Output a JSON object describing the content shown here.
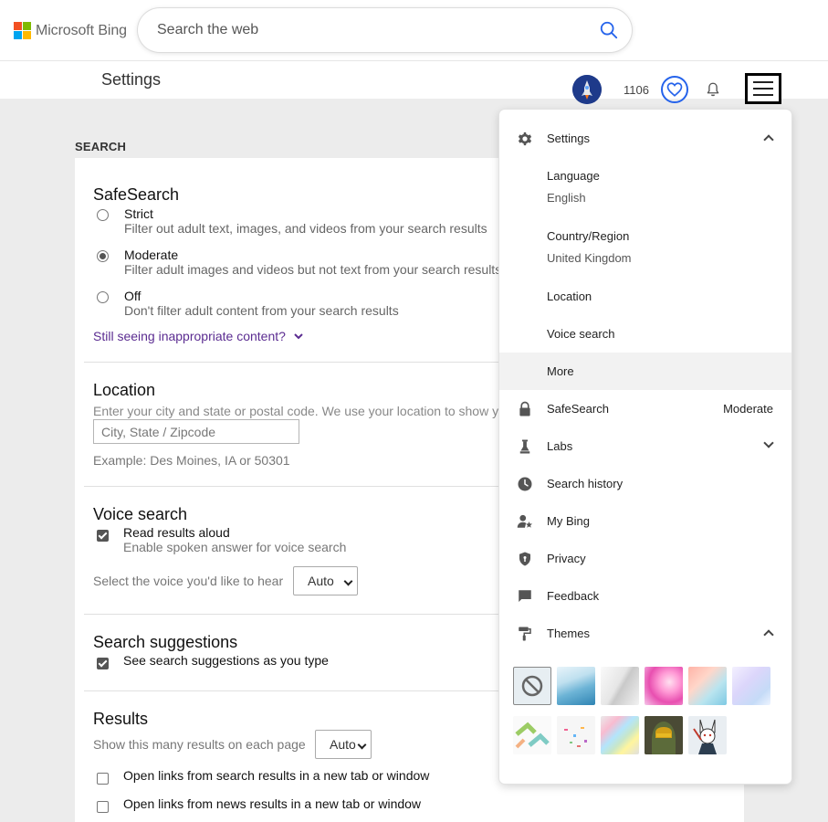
{
  "brand": {
    "name": "Microsoft Bing",
    "colors": [
      "#f25022",
      "#7fba00",
      "#00a4ef",
      "#ffb900"
    ]
  },
  "search": {
    "placeholder": "Search the web",
    "value": "",
    "icon": "search-icon"
  },
  "subbar": {
    "title": "Settings",
    "points": "1106",
    "icons": [
      "avatar",
      "heart-icon",
      "bell-icon",
      "hamburger-menu-icon"
    ]
  },
  "main": {
    "section_heading": "SEARCH",
    "safesearch": {
      "title": "SafeSearch",
      "selected": "Moderate",
      "options": [
        {
          "label": "Strict",
          "desc": "Filter out adult text, images, and videos from your search results"
        },
        {
          "label": "Moderate",
          "desc": "Filter adult images and videos but not text from your search results"
        },
        {
          "label": "Off",
          "desc": "Don't filter adult content from your search results"
        }
      ],
      "link": "Still seeing inappropriate content?"
    },
    "location": {
      "title": "Location",
      "desc": "Enter your city and state or postal code. We use your location to show y",
      "placeholder": "City, State / Zipcode",
      "value": "",
      "example": "Example: Des Moines, IA or 50301"
    },
    "voice": {
      "title": "Voice search",
      "checkbox_label": "Read results aloud",
      "checkbox_desc": "Enable spoken answer for voice search",
      "checked": true,
      "voice_prompt": "Select the voice you'd like to hear",
      "voice_value": "Auto"
    },
    "suggestions": {
      "title": "Search suggestions",
      "checkbox_label": "See search suggestions as you type",
      "checked": true
    },
    "results": {
      "title": "Results",
      "count_prompt": "Show this many results on each page",
      "count_value": "Auto",
      "new_tab_search": "Open links from search results in a new tab or window",
      "new_tab_news": "Open links from news results in a new tab or window"
    }
  },
  "menu": {
    "settings": {
      "label": "Settings",
      "icon": "gear-icon",
      "expanded": true
    },
    "language": {
      "label": "Language",
      "value": "English"
    },
    "country": {
      "label": "Country/Region",
      "value": "United Kingdom"
    },
    "location": {
      "label": "Location"
    },
    "voice": {
      "label": "Voice search"
    },
    "more": {
      "label": "More"
    },
    "safesearch": {
      "label": "SafeSearch",
      "value": "Moderate",
      "icon": "lock-icon"
    },
    "labs": {
      "label": "Labs",
      "icon": "flask-icon"
    },
    "history": {
      "label": "Search history",
      "icon": "clock-icon"
    },
    "mybing": {
      "label": "My Bing",
      "icon": "person-star-icon"
    },
    "privacy": {
      "label": "Privacy",
      "icon": "shield-icon"
    },
    "feedback": {
      "label": "Feedback",
      "icon": "chat-bubble-icon"
    },
    "themes": {
      "label": "Themes",
      "icon": "paint-roller-icon",
      "expanded": true
    },
    "theme_tiles": [
      "no-theme",
      "blue-waves",
      "gray-light",
      "pink-bubbles",
      "peach-gradient",
      "lavender-gradient",
      "green-arrows",
      "confetti",
      "rainbow-prism",
      "halo-chief",
      "bunny-character"
    ]
  }
}
